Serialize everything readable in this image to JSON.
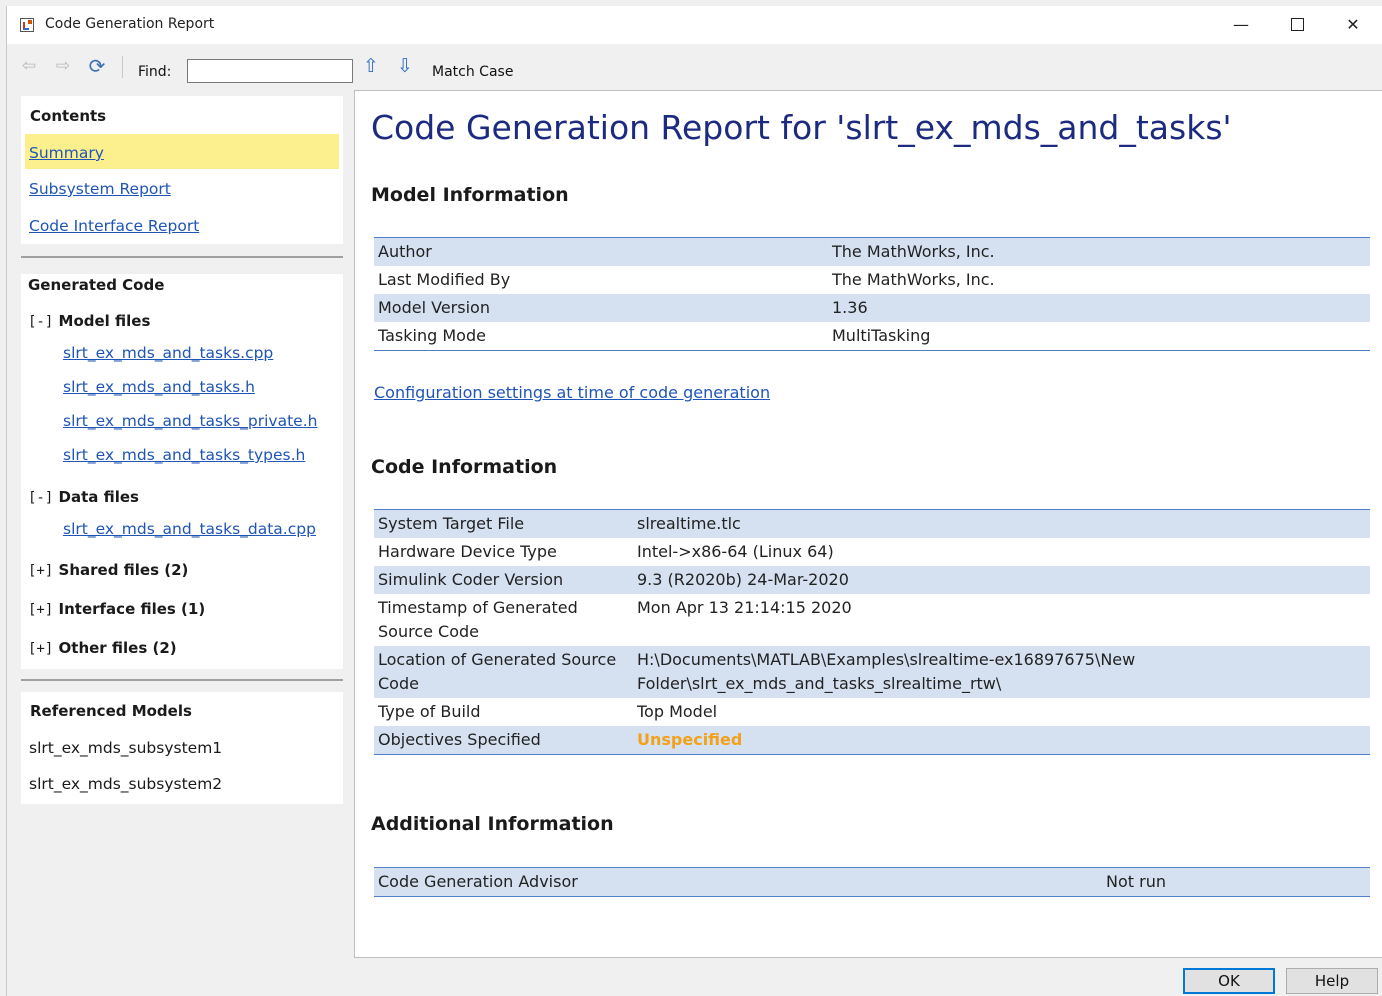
{
  "window": {
    "title": "Code Generation Report"
  },
  "toolbar": {
    "find_label": "Find:",
    "find_value": "",
    "match_case": "Match Case"
  },
  "nav": {
    "contents_heading": "Contents",
    "contents": [
      {
        "label": "Summary"
      },
      {
        "label": "Subsystem Report"
      },
      {
        "label": "Code Interface Report"
      }
    ],
    "generated_heading": "Generated Code",
    "groups": {
      "model_files": {
        "toggle": "[-]",
        "label": "Model files",
        "files": [
          "slrt_ex_mds_and_tasks.cpp",
          "slrt_ex_mds_and_tasks.h",
          "slrt_ex_mds_and_tasks_private.h",
          "slrt_ex_mds_and_tasks_types.h"
        ]
      },
      "data_files": {
        "toggle": "[-]",
        "label": "Data files",
        "files": [
          "slrt_ex_mds_and_tasks_data.cpp"
        ]
      },
      "shared_files": {
        "toggle": "[+]",
        "label": "Shared files (2)"
      },
      "interface_files": {
        "toggle": "[+]",
        "label": "Interface files (1)"
      },
      "other_files": {
        "toggle": "[+]",
        "label": "Other files (2)"
      }
    },
    "referenced_heading": "Referenced Models",
    "referenced": [
      "slrt_ex_mds_subsystem1",
      "slrt_ex_mds_subsystem2"
    ]
  },
  "report": {
    "title": "Code Generation Report for 'slrt_ex_mds_and_tasks'",
    "model_info": {
      "heading": "Model Information",
      "rows": [
        {
          "key": "Author",
          "value": "The MathWorks, Inc."
        },
        {
          "key": "Last Modified By",
          "value": "The MathWorks, Inc."
        },
        {
          "key": "Model Version",
          "value": "1.36"
        },
        {
          "key": "Tasking Mode",
          "value": "MultiTasking"
        }
      ]
    },
    "config_link": "Configuration settings at time of code generation",
    "code_info": {
      "heading": "Code Information",
      "rows": [
        {
          "key": "System Target File",
          "value": "slrealtime.tlc"
        },
        {
          "key": "Hardware Device Type",
          "value": "Intel->x86-64 (Linux 64)"
        },
        {
          "key": "Simulink Coder Version",
          "value": "9.3 (R2020b) 24-Mar-2020"
        },
        {
          "key": "Timestamp of Generated Source Code",
          "value": "Mon Apr 13 21:14:15 2020"
        },
        {
          "key": "Location of Generated Source Code",
          "value": "H:\\Documents\\MATLAB\\Examples\\slrealtime-ex16897675\\New Folder\\slrt_ex_mds_and_tasks_slrealtime_rtw\\"
        },
        {
          "key": "Type of Build",
          "value": "Top Model"
        },
        {
          "key": "Objectives Specified",
          "value": "Unspecified"
        }
      ]
    },
    "additional_info": {
      "heading": "Additional Information",
      "rows": [
        {
          "key": "Code Generation Advisor",
          "value": "Not run"
        }
      ]
    }
  },
  "buttons": {
    "ok": "OK",
    "help": "Help"
  },
  "colors": {
    "accent": "#0078d7",
    "link": "#1f55b6",
    "title": "#1c2a80",
    "row_shade": "#d5e1f1",
    "warning": "#f2a11a",
    "highlight": "#fcf08e"
  }
}
